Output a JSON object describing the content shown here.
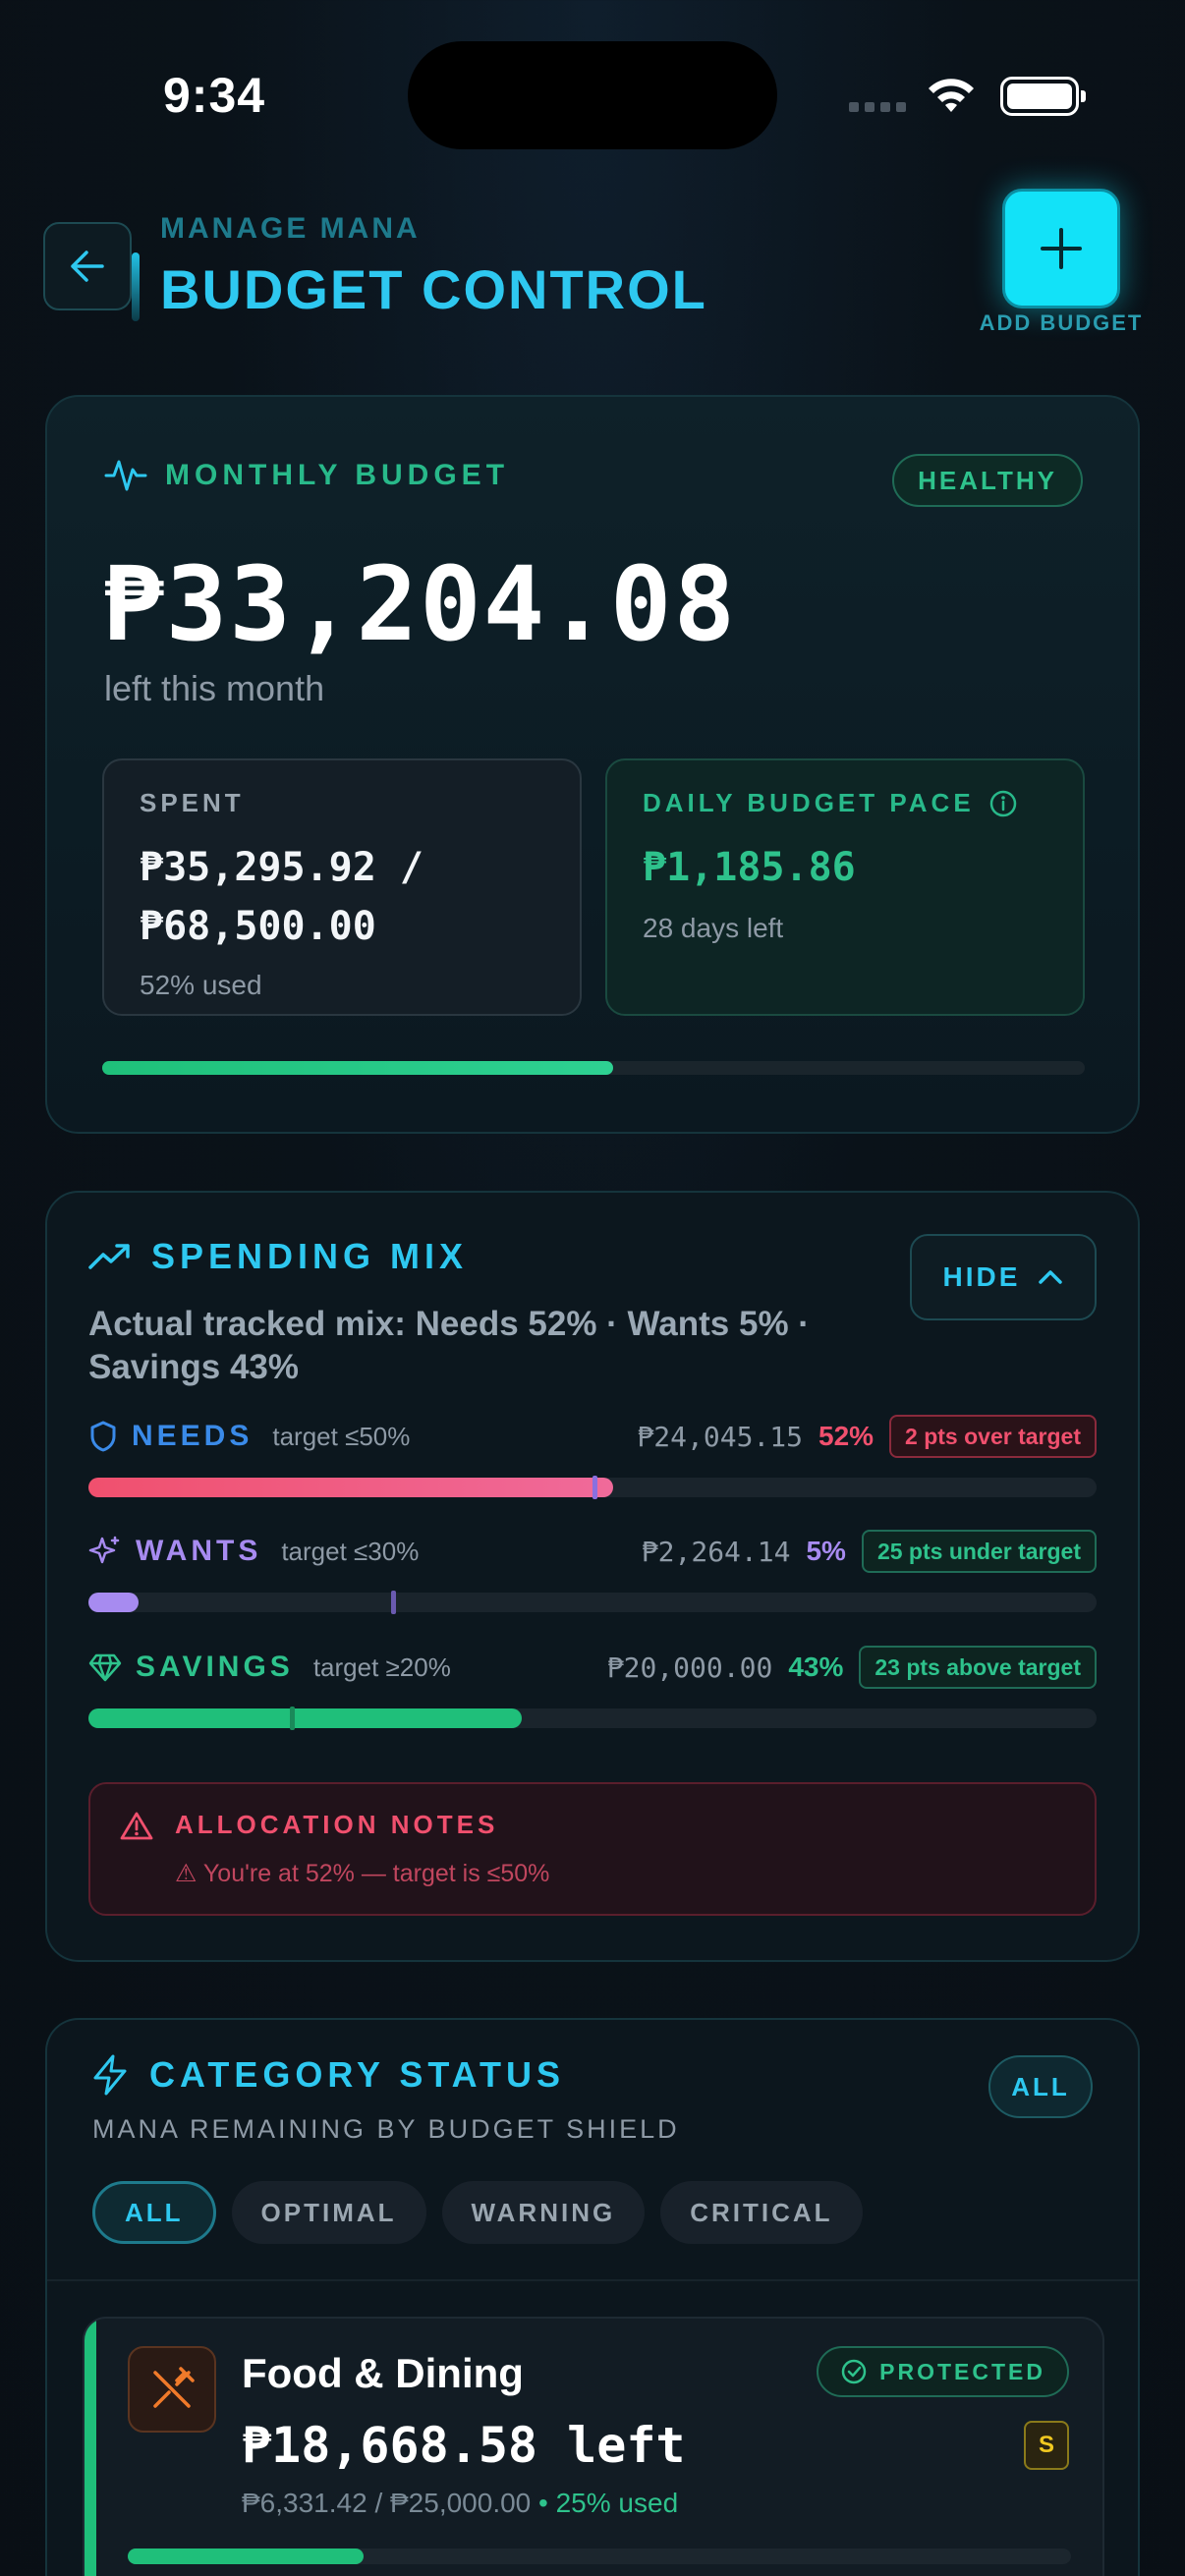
{
  "status_bar": {
    "time": "9:34"
  },
  "header": {
    "eyebrow": "MANAGE MANA",
    "title": "BUDGET CONTROL",
    "add_label": "ADD BUDGET"
  },
  "monthly_budget": {
    "title": "MONTHLY BUDGET",
    "status": "HEALTHY",
    "amount_left": "₱33,204.08",
    "left_label": "left this month",
    "spent": {
      "label": "SPENT",
      "value": "₱35,295.92 / ₱68,500.00",
      "sub": "52% used"
    },
    "pace": {
      "label": "DAILY BUDGET PACE",
      "value": "₱1,185.86",
      "sub": "28 days left"
    },
    "progress_percent": 52,
    "colors": {
      "accent": "#2ec28c"
    }
  },
  "spending_mix": {
    "title": "SPENDING MIX",
    "hide_label": "HIDE",
    "summary": "Actual tracked mix: Needs 52% · Wants 5% · Savings 43%",
    "rows": [
      {
        "name": "NEEDS",
        "target": "target ≤50%",
        "amount": "₱24,045.15",
        "pct": "52%",
        "pill": "2 pts over target",
        "fill_percent": 52,
        "marker_percent": 50
      },
      {
        "name": "WANTS",
        "target": "target ≤30%",
        "amount": "₱2,264.14",
        "pct": "5%",
        "pill": "25 pts under target",
        "fill_percent": 5,
        "marker_percent": 30
      },
      {
        "name": "SAVINGS",
        "target": "target ≥20%",
        "amount": "₱20,000.00",
        "pct": "43%",
        "pill": "23 pts above target",
        "fill_percent": 43,
        "marker_percent": 20
      }
    ],
    "notes": {
      "title": "ALLOCATION NOTES",
      "body": "⚠ You're at 52% — target is ≤50%"
    },
    "colors": {
      "needs": "#f0506e",
      "wants": "#a78bf0",
      "savings": "#2ec28c"
    }
  },
  "category_status": {
    "title": "CATEGORY STATUS",
    "subtitle": "MANA REMAINING BY BUDGET SHIELD",
    "all_badge": "ALL",
    "filters": [
      "ALL",
      "OPTIMAL",
      "WARNING",
      "CRITICAL"
    ],
    "items": [
      {
        "name": "Food & Dining",
        "left": "₱18,668.58 left",
        "spent_of": "₱6,331.42 / ₱25,000.00",
        "used": " • 25% used",
        "status": "PROTECTED",
        "badge": "S",
        "progress_percent": 25,
        "icon": "utensils-crossed-icon"
      }
    ]
  }
}
